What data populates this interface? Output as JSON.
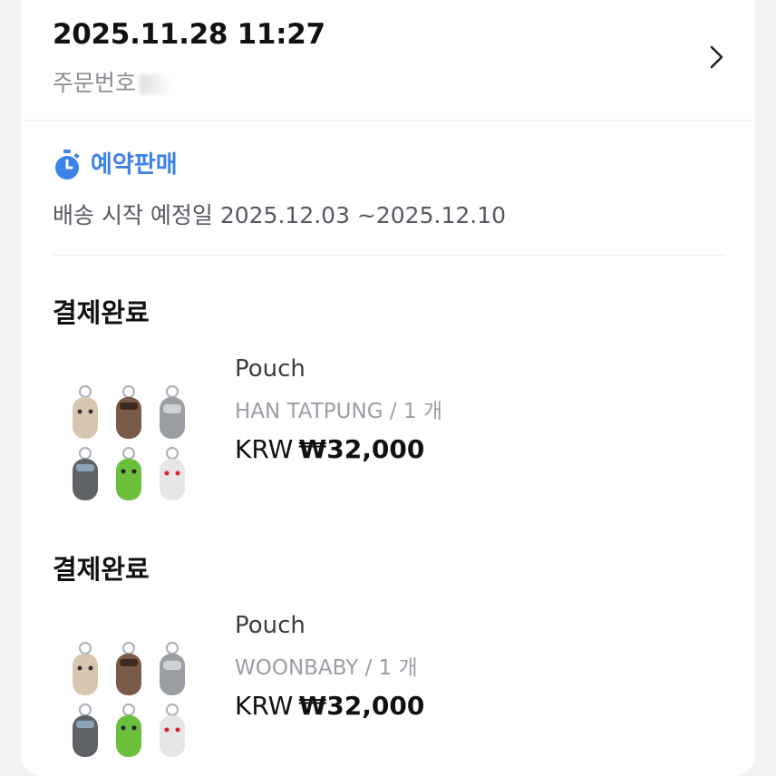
{
  "order": {
    "datetime": "2025.11.28 11:27",
    "number_label": "주문번호"
  },
  "preorder": {
    "label": "예약판매",
    "shipping_text": "배송 시작 예정일 2025.12.03 ~2025.12.10"
  },
  "items": [
    {
      "status": "결제완료",
      "name": "Pouch",
      "option": "HAN TATPUNG / 1 개",
      "currency": "KRW",
      "price": "₩32,000"
    },
    {
      "status": "결제완료",
      "name": "Pouch",
      "option": "WOONBABY / 1 개",
      "currency": "KRW",
      "price": "₩32,000"
    }
  ],
  "icons": {
    "chevron": "chevron-right-icon",
    "preorder": "stopwatch-icon"
  },
  "colors": {
    "accent": "#3c82e8",
    "background": "#f2f3f5",
    "card": "#ffffff"
  }
}
